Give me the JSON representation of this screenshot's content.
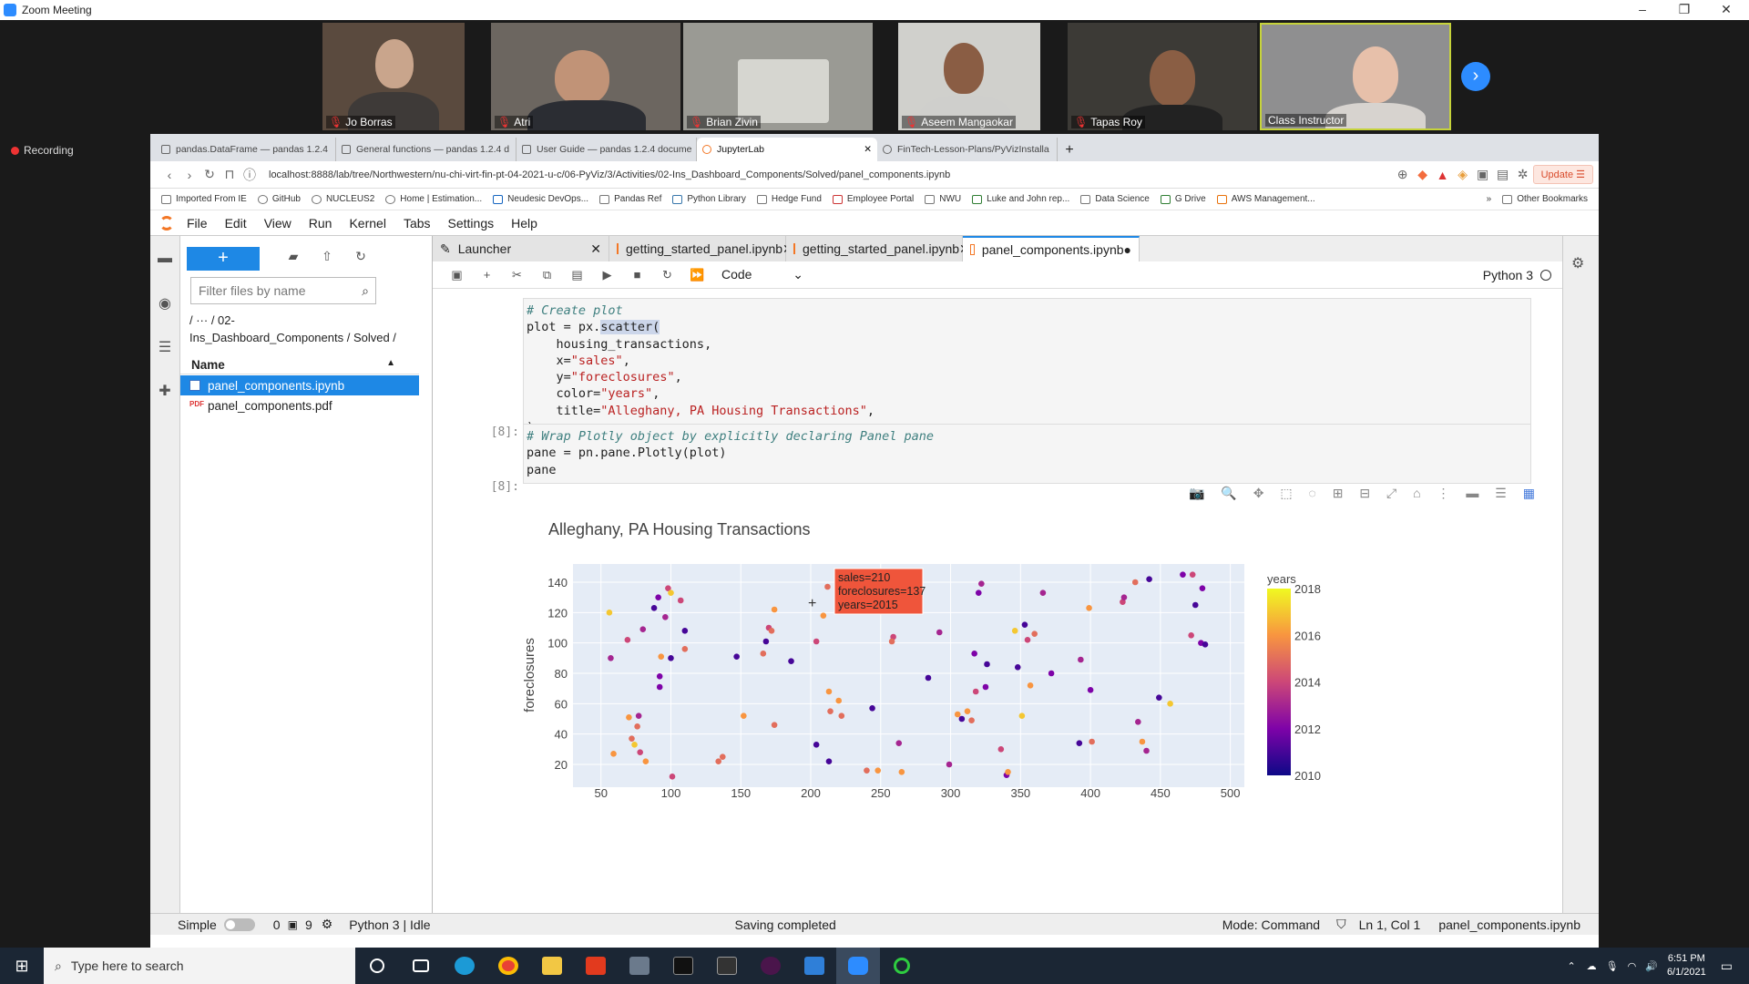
{
  "zoom": {
    "title": "Zoom Meeting",
    "recording": "Recording",
    "participants": [
      {
        "name": "Jo Borras"
      },
      {
        "name": "Atri"
      },
      {
        "name": "Brian Zivin"
      },
      {
        "name": "Aseem Mangaokar"
      },
      {
        "name": "Tapas Roy"
      },
      {
        "name": "Class Instructor"
      }
    ]
  },
  "browser": {
    "tabs": [
      {
        "label": "pandas.DataFrame — pandas 1.2.4"
      },
      {
        "label": "General functions — pandas 1.2.4 d"
      },
      {
        "label": "User Guide — pandas 1.2.4 docume"
      },
      {
        "label": "JupyterLab"
      },
      {
        "label": "FinTech-Lesson-Plans/PyVizInstalla"
      }
    ],
    "url": "localhost:8888/lab/tree/Northwestern/nu-chi-virt-fin-pt-04-2021-u-c/06-PyViz/3/Activities/02-Ins_Dashboard_Components/Solved/panel_components.ipynb",
    "update_label": "Update",
    "bookmarks": [
      "Imported From IE",
      "GitHub",
      "NUCLEUS2",
      "Home | Estimation...",
      "Neudesic DevOps...",
      "Pandas Ref",
      "Python Library",
      "Hedge Fund",
      "Employee Portal",
      "NWU",
      "Luke and John rep...",
      "Data Science",
      "G Drive",
      "AWS Management..."
    ],
    "more_bookmarks": "»",
    "other_bookmarks": "Other Bookmarks"
  },
  "jupyter": {
    "menu": [
      "File",
      "Edit",
      "View",
      "Run",
      "Kernel",
      "Tabs",
      "Settings",
      "Help"
    ],
    "filter_placeholder": "Filter files by name",
    "breadcrumb_line1": "/   ···   / 02-",
    "breadcrumb_line2": "Ins_Dashboard_Components / Solved /",
    "name_header": "Name",
    "files": [
      "panel_components.ipynb",
      "panel_components.pdf"
    ],
    "doc_tabs": [
      "Launcher",
      "getting_started_panel.ipynb",
      "getting_started_panel.ipynb",
      "panel_components.ipynb"
    ],
    "cell_type": "Code",
    "kernel_name": "Python 3",
    "prompt_in": "[8]:",
    "prompt_out": "[8]:",
    "status": {
      "mode_label": "Simple",
      "n1": "0",
      "n2": "9",
      "kernel": "Python 3 | Idle",
      "saving": "Saving completed",
      "mode": "Mode: Command",
      "cursor": "Ln 1, Col 1",
      "file": "panel_components.ipynb"
    }
  },
  "cells": {
    "code1": {
      "comment": "# Create plot",
      "l2a": "plot = px.",
      "l2b": "scatter(",
      "l3": "    housing_transactions,",
      "l4a": "    x=",
      "l4b": "\"sales\"",
      "l4c": ",",
      "l5a": "    y=",
      "l5b": "\"foreclosures\"",
      "l5c": ",",
      "l6a": "    color=",
      "l6b": "\"years\"",
      "l6c": ",",
      "l7a": "    title=",
      "l7b": "\"Alleghany, PA Housing Transactions\"",
      "l7c": ",",
      "l8": ")"
    },
    "code2": {
      "comment": "# Wrap Plotly object by explicitly declaring Panel pane",
      "l2": "pane = pn.pane.Plotly(plot)",
      "l3": "pane"
    }
  },
  "chart_data": {
    "type": "scatter",
    "title": "Alleghany, PA Housing Transactions",
    "xlabel": "",
    "ylabel": "foreclosures",
    "xlim": [
      30,
      510
    ],
    "ylim": [
      5,
      152
    ],
    "yticks": [
      20,
      40,
      60,
      80,
      100,
      120,
      140
    ],
    "xticks": [
      50,
      100,
      150,
      200,
      250,
      300,
      350,
      400,
      450,
      500
    ],
    "colorbar": {
      "title": "years",
      "min": 2010,
      "max": 2018,
      "ticks": [
        2010,
        2012,
        2014,
        2016,
        2018
      ]
    },
    "tooltip": {
      "line1": "sales=210",
      "line2": "foreclosures=137",
      "line3": "years=2015"
    },
    "points": [
      [
        56,
        120,
        2017
      ],
      [
        57,
        90,
        2013
      ],
      [
        59,
        27,
        2016
      ],
      [
        69,
        102,
        2014
      ],
      [
        70,
        51,
        2016
      ],
      [
        72,
        37,
        2015
      ],
      [
        74,
        33,
        2017
      ],
      [
        76,
        45,
        2015
      ],
      [
        77,
        52,
        2013
      ],
      [
        78,
        28,
        2014
      ],
      [
        80,
        109,
        2013
      ],
      [
        82,
        22,
        2016
      ],
      [
        88,
        123,
        2011
      ],
      [
        91,
        130,
        2012
      ],
      [
        92,
        78,
        2012
      ],
      [
        92,
        71,
        2012
      ],
      [
        93,
        91,
        2016
      ],
      [
        96,
        117,
        2013
      ],
      [
        98,
        136,
        2014
      ],
      [
        100,
        133,
        2017
      ],
      [
        100,
        90,
        2011
      ],
      [
        101,
        12,
        2014
      ],
      [
        107,
        128,
        2014
      ],
      [
        110,
        108,
        2011
      ],
      [
        110,
        96,
        2015
      ],
      [
        134,
        22,
        2015
      ],
      [
        137,
        25,
        2015
      ],
      [
        147,
        91,
        2011
      ],
      [
        152,
        52,
        2016
      ],
      [
        166,
        93,
        2015
      ],
      [
        168,
        101,
        2011
      ],
      [
        170,
        110,
        2014
      ],
      [
        172,
        108,
        2015
      ],
      [
        174,
        122,
        2016
      ],
      [
        174,
        46,
        2015
      ],
      [
        186,
        88,
        2011
      ],
      [
        212,
        137,
        2015
      ],
      [
        209,
        118,
        2016
      ],
      [
        204,
        101,
        2014
      ],
      [
        213,
        68,
        2016
      ],
      [
        214,
        55,
        2015
      ],
      [
        220,
        62,
        2016
      ],
      [
        222,
        52,
        2015
      ],
      [
        204,
        33,
        2011
      ],
      [
        213,
        22,
        2011
      ],
      [
        240,
        16,
        2015
      ],
      [
        244,
        57,
        2011
      ],
      [
        248,
        16,
        2016
      ],
      [
        259,
        104,
        2014
      ],
      [
        263,
        34,
        2013
      ],
      [
        265,
        15,
        2016
      ],
      [
        275,
        127,
        2014
      ],
      [
        284,
        77,
        2011
      ],
      [
        292,
        107,
        2013
      ],
      [
        299,
        20,
        2013
      ],
      [
        305,
        53,
        2016
      ],
      [
        308,
        50,
        2011
      ],
      [
        312,
        55,
        2016
      ],
      [
        315,
        49,
        2015
      ],
      [
        317,
        93,
        2012
      ],
      [
        318,
        68,
        2014
      ],
      [
        320,
        133,
        2012
      ],
      [
        322,
        139,
        2013
      ],
      [
        325,
        71,
        2012
      ],
      [
        326,
        86,
        2011
      ],
      [
        336,
        30,
        2014
      ],
      [
        340,
        13,
        2012
      ],
      [
        341,
        15,
        2016
      ],
      [
        346,
        108,
        2017
      ],
      [
        348,
        84,
        2011
      ],
      [
        351,
        52,
        2017
      ],
      [
        353,
        112,
        2011
      ],
      [
        355,
        102,
        2014
      ],
      [
        357,
        72,
        2016
      ],
      [
        360,
        106,
        2015
      ],
      [
        366,
        133,
        2013
      ],
      [
        372,
        80,
        2012
      ],
      [
        392,
        34,
        2011
      ],
      [
        393,
        89,
        2013
      ],
      [
        399,
        123,
        2016
      ],
      [
        400,
        69,
        2012
      ],
      [
        401,
        35,
        2015
      ],
      [
        423,
        127,
        2014
      ],
      [
        424,
        130,
        2013
      ],
      [
        432,
        140,
        2015
      ],
      [
        434,
        48,
        2013
      ],
      [
        437,
        35,
        2016
      ],
      [
        440,
        29,
        2013
      ],
      [
        442,
        142,
        2011
      ],
      [
        449,
        64,
        2011
      ],
      [
        457,
        60,
        2017
      ],
      [
        466,
        145,
        2012
      ],
      [
        472,
        105,
        2014
      ],
      [
        473,
        145,
        2014
      ],
      [
        475,
        125,
        2011
      ],
      [
        479,
        100,
        2012
      ],
      [
        480,
        136,
        2012
      ],
      [
        482,
        99,
        2011
      ],
      [
        258,
        101,
        2015
      ]
    ]
  }
}
